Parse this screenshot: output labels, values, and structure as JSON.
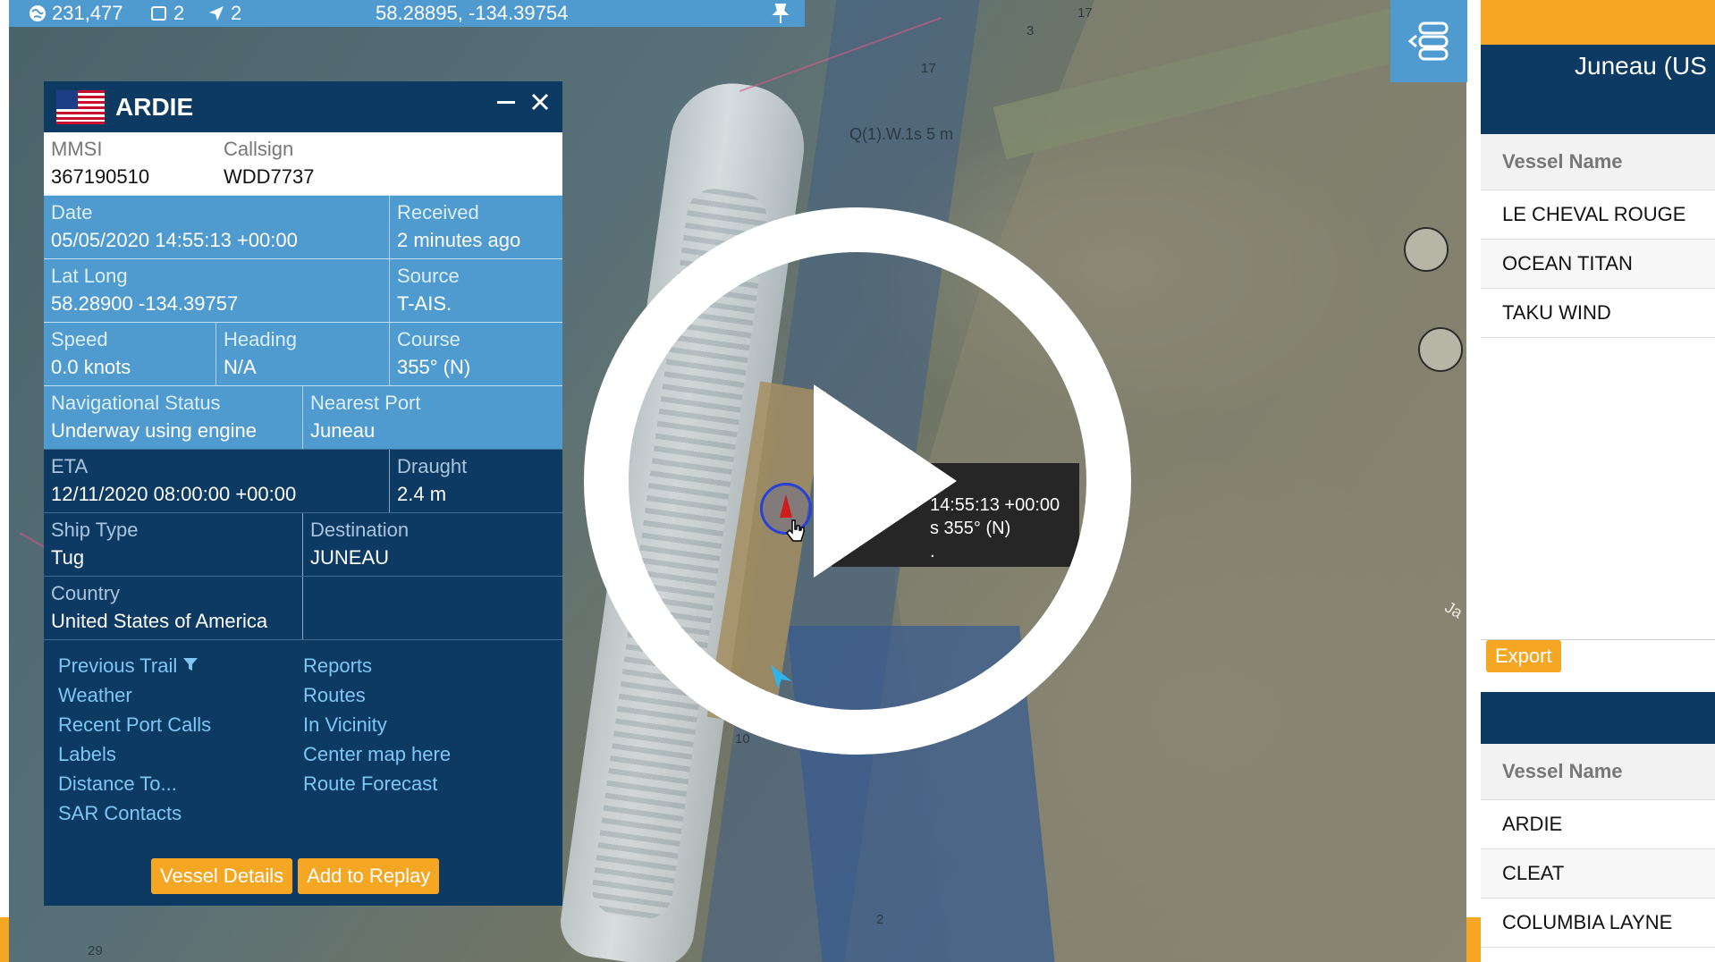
{
  "statusbar": {
    "globe_count": "231,477",
    "square_count": "2",
    "arrow_count": "2",
    "cursor_coords": "58.28895, -134.39754"
  },
  "popup": {
    "title": "ARDIE",
    "fields": {
      "mmsi_label": "MMSI",
      "mmsi": "367190510",
      "callsign_label": "Callsign",
      "callsign": "WDD7737",
      "date_label": "Date",
      "date": "05/05/2020 14:55:13 +00:00",
      "received_label": "Received",
      "received": "2 minutes ago",
      "latlong_label": "Lat Long",
      "latlong": "58.28900 -134.39757",
      "source_label": "Source",
      "source": "T-AIS.",
      "speed_label": "Speed",
      "speed": "0.0 knots",
      "heading_label": "Heading",
      "heading": "N/A",
      "course_label": "Course",
      "course": "355° (N)",
      "navstatus_label": "Navigational Status",
      "navstatus": "Underway using engine",
      "nearestport_label": "Nearest Port",
      "nearestport": "Juneau",
      "eta_label": "ETA",
      "eta": "12/11/2020 08:00:00 +00:00",
      "draught_label": "Draught",
      "draught": "2.4 m",
      "shiptype_label": "Ship Type",
      "shiptype": "Tug",
      "destination_label": "Destination",
      "destination": "JUNEAU",
      "country_label": "Country",
      "country": "United States of America"
    },
    "links_left": [
      "Previous Trail",
      "Weather",
      "Recent Port Calls",
      "Labels",
      "Distance To...",
      "SAR Contacts"
    ],
    "links_right": [
      "Reports",
      "Routes",
      "In Vicinity",
      "Center map here",
      "Route Forecast"
    ],
    "vessel_details_label": "Vessel Details",
    "add_to_replay_label": "Add to Replay"
  },
  "tooltip": {
    "line1": "14:55:13 +00:00",
    "line2": "s 355° (N)",
    "line3": "."
  },
  "map_labels": {
    "light": "Q(1).W.1s 5 m",
    "depth_17a": "17",
    "depth_17b": "17",
    "depth_173": "17",
    "depth_3": "3",
    "depth_103": "10",
    "depth_21": "2",
    "depth_29": "29",
    "edge_text": "Ja"
  },
  "sidebar": {
    "title": "Juneau (US",
    "column_header": "Vessel Name",
    "list1": [
      "LE CHEVAL ROUGE",
      "OCEAN TITAN",
      "TAKU WIND"
    ],
    "export_label": "Export",
    "column_header2": "Vessel Name",
    "list2": [
      "ARDIE",
      "CLEAT",
      "COLUMBIA LAYNE"
    ]
  },
  "colors": {
    "accent_blue": "#4f9bd0",
    "navy": "#0c3a63",
    "orange": "#f5a623"
  }
}
